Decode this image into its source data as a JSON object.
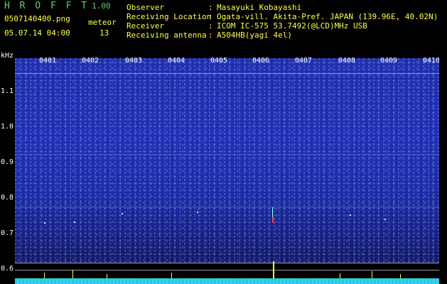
{
  "header": {
    "app_name": "H R O F F T",
    "version": "1.00",
    "filename": "0507140400.png",
    "meteor_label": "meteor",
    "datetime": "05.07.14 04:00",
    "meteor_count": "13",
    "meta_labels": [
      "Observer",
      "Receiving Location",
      "Receiver",
      "Receiving antenna"
    ],
    "meta_colons": [
      ":",
      ":",
      ":",
      ":"
    ],
    "meta_values": [
      "Masayuki Kobayashi",
      "Ogata-vill. Akita-Pref. JAPAN (139.96E, 40.02N)",
      "ICOM IC-575 53.7492(@LCD)MHz USB",
      "A504HB(yagi 4el)"
    ]
  },
  "axis": {
    "unit": "kHz",
    "y_ticks": [
      "1.1",
      "1.0",
      "0.9",
      "0.8",
      "0.7",
      "0.6"
    ],
    "time_labels": [
      "0401",
      "0402",
      "0403",
      "0404",
      "0405",
      "0406",
      "0407",
      "0408",
      "0409",
      "0410"
    ]
  },
  "colors": {
    "accent_green": "#5fd35f",
    "label_yellow": "#ffff3c",
    "spectrogram_blue": "#1a2aa8",
    "floor_cyan": "#40e0f0"
  }
}
